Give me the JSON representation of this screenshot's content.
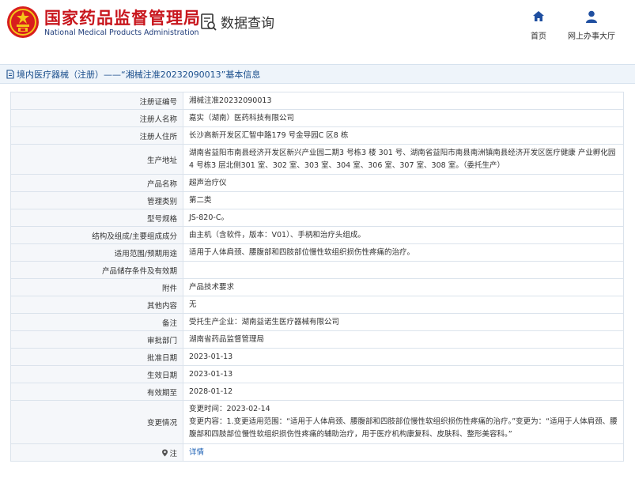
{
  "header": {
    "org_name_cn": "国家药品监督管理局",
    "org_name_en": "National Medical Products Administration",
    "query_label": "数据查询",
    "nav": [
      {
        "label": "首页",
        "icon": "home-icon"
      },
      {
        "label": "网上办事大厅",
        "icon": "user-icon"
      }
    ]
  },
  "page_title": "境内医疗器械（注册）——“湘械注准20232090013”基本信息",
  "colors": {
    "brand_red": "#c8161d",
    "brand_blue": "#1f3c7a",
    "title_blue": "#1a4e8c",
    "link_blue": "#1a5fb4",
    "label_bg": "#f5f7fa",
    "border": "#dbe3ec"
  },
  "rows": [
    {
      "label": "注册证编号",
      "value": "湘械注准20232090013"
    },
    {
      "label": "注册人名称",
      "value": "嘉实（湖南）医药科技有限公司"
    },
    {
      "label": "注册人住所",
      "value": "长沙高新开发区汇智中路179 号金导园C 区8 栋"
    },
    {
      "label": "生产地址",
      "value": "湖南省益阳市南县经济开发区新兴产业园二期3 号栋3 楼 301 号、湖南省益阳市南县南洲镇南县经济开发区医疗健康 产业孵化园4 号栋3 层北侧301 室、302 室、303 室、304 室、306 室、307 室、308 室。（委托生产）"
    },
    {
      "label": "产品名称",
      "value": "超声治疗仪"
    },
    {
      "label": "管理类别",
      "value": "第二类"
    },
    {
      "label": "型号规格",
      "value": "JS-820-C。"
    },
    {
      "label": "结构及组成/主要组成成分",
      "value": "由主机（含软件，版本：V01）、手柄和治疗头组成。"
    },
    {
      "label": "适用范围/预期用途",
      "value": "适用于人体肩颈、腰腹部和四肢部位慢性软组织损伤性疼痛的治疗。"
    },
    {
      "label": "产品储存条件及有效期",
      "value": ""
    },
    {
      "label": "附件",
      "value": "产品技术要求"
    },
    {
      "label": "其他内容",
      "value": "无"
    },
    {
      "label": "备注",
      "value": "受托生产企业：湖南益诺生医疗器械有限公司"
    },
    {
      "label": "审批部门",
      "value": "湖南省药品监督管理局"
    },
    {
      "label": "批准日期",
      "value": "2023-01-13"
    },
    {
      "label": "生效日期",
      "value": "2023-01-13"
    },
    {
      "label": "有效期至",
      "value": "2028-01-12"
    }
  ],
  "change": {
    "label": "变更情况",
    "time_line": "变更时间：2023-02-14",
    "content_line": "变更内容：1.变更适用范围：“适用于人体肩颈、腰腹部和四肢部位慢性软组织损伤性疼痛的治疗。”变更为：“适用于人体肩颈、腰腹部和四肢部位慢性软组织损伤性疼痛的辅助治疗，用于医疗机构康复科、皮肤科、整形美容科。”"
  },
  "note_row": {
    "label": "注",
    "link_label": "详情"
  }
}
